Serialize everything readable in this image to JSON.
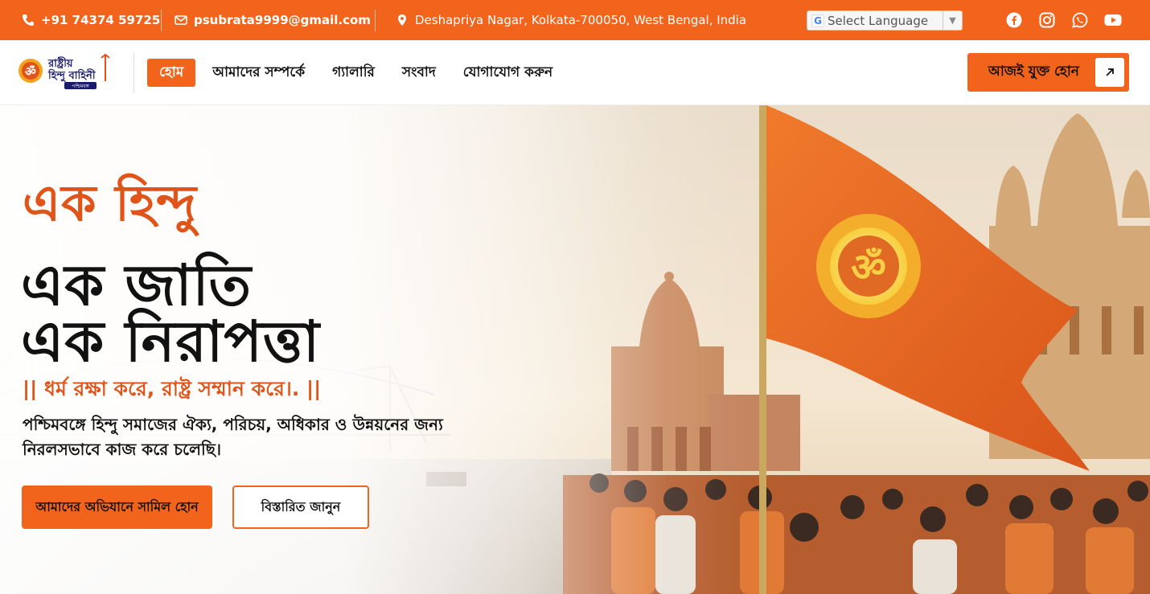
{
  "topbar": {
    "phone": "+91 74374 59725",
    "email": "psubrata9999@gmail.com",
    "address": "Deshapriya Nagar, Kolkata-700050, West Bengal, India",
    "language_label": "Select Language",
    "language_arrow": "▼",
    "social_icons": [
      "facebook-icon",
      "instagram-icon",
      "whatsapp-icon",
      "youtube-icon"
    ]
  },
  "logo": {
    "line1": "রাষ্ট্রীয়",
    "line2": "হিন্দু বাহিনী",
    "line3": "পশ্চিমবঙ্গ"
  },
  "nav": {
    "items": [
      {
        "label": "হোম",
        "active": true
      },
      {
        "label": "আমাদের সম্পর্কে",
        "active": false
      },
      {
        "label": "গ্যালারি",
        "active": false
      },
      {
        "label": "সংবাদ",
        "active": false
      },
      {
        "label": "যোগাযোগ করুন",
        "active": false
      }
    ],
    "join_label": "আজই যুক্ত হোন"
  },
  "hero": {
    "tagline": "এক হিন্দু",
    "line1": "এক জাতি",
    "line2": "এক নিরাপত্তা",
    "slogan": "|| ধর্ম রক্ষা করে, রাষ্ট্র সম্মান করে।. ||",
    "description": "পশ্চিমবঙ্গে হিন্দু সমাজের ঐক্য, পরিচয়, অধিকার ও উন্নয়নের জন্য নিরলসভাবে কাজ করে চলেছি।",
    "primary_button": "আমাদের অভিযানে সামিল হোন",
    "secondary_button": "বিস্তারিত জানুন"
  },
  "colors": {
    "brand_orange": "#f2641c",
    "heading_orange": "#e0541a",
    "text_dark": "#111111"
  }
}
